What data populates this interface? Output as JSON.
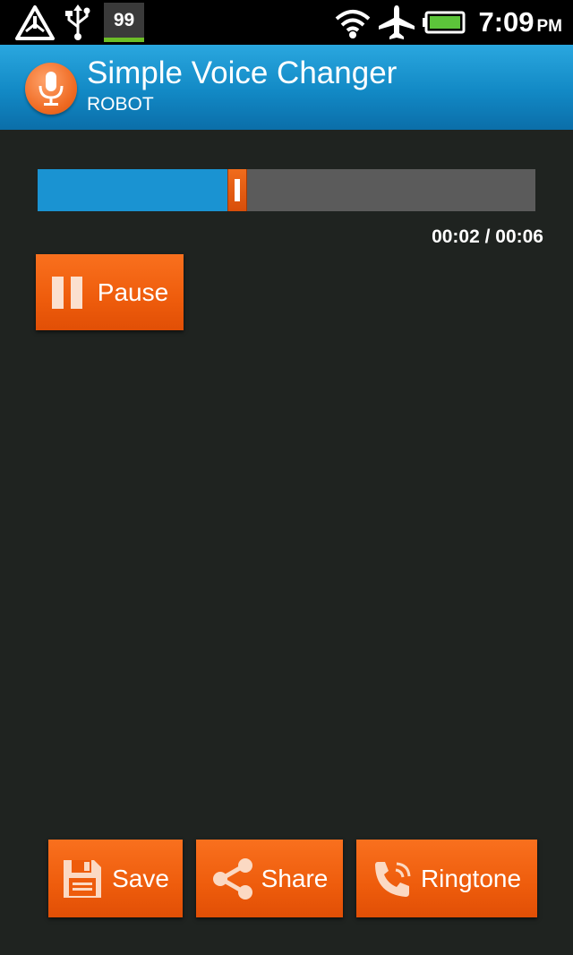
{
  "status_bar": {
    "notification_count": "99",
    "time": "7:09",
    "ampm": "PM",
    "icons": [
      "warning-icon",
      "usb-icon",
      "wifi-icon",
      "airplane-mode-icon",
      "battery-icon"
    ]
  },
  "app_bar": {
    "title": "Simple Voice Changer",
    "subtitle": "ROBOT",
    "icon": "microphone-icon"
  },
  "player": {
    "elapsed": "00:02",
    "duration": "00:06",
    "time_text": "00:02 / 00:06",
    "progress_fraction": 0.4,
    "pause_label": "Pause"
  },
  "actions": {
    "save_label": "Save",
    "share_label": "Share",
    "ringtone_label": "Ringtone"
  },
  "colors": {
    "accent_orange": "#ee5c0c",
    "progress_blue": "#1a93d2",
    "titlebar_blue": "#1289c5",
    "background": "#1f2320"
  }
}
